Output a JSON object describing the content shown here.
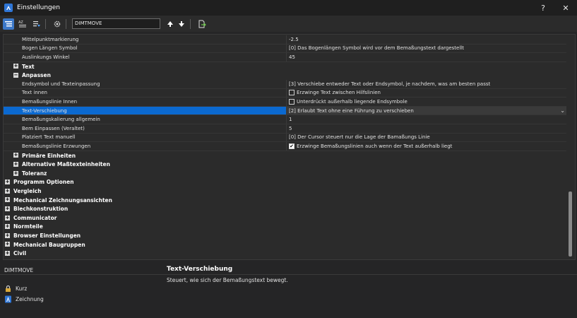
{
  "window": {
    "title": "Einstellungen",
    "help": "?",
    "close": "✕"
  },
  "toolbar": {
    "search_value": "DIMTMOVE"
  },
  "properties": [
    {
      "type": "prop",
      "name": "Mittelpunktmarkierung",
      "value": "-2.5"
    },
    {
      "type": "prop",
      "name": "Bogen Längen Symbol",
      "value": "[0] Das Bogenlängen Symbol wird vor dem Bemaßungstext dargestellt"
    },
    {
      "type": "prop",
      "name": "Auslinkungs Winkel",
      "value": "45"
    },
    {
      "type": "group",
      "level": 1,
      "expander": "+",
      "name": "Text"
    },
    {
      "type": "group",
      "level": 1,
      "expander": "−",
      "name": "Anpassen"
    },
    {
      "type": "prop",
      "name": "Endsymbol und Texteinpassung",
      "value": "[3] Verschiebe entweder Text oder Endsymbol, je nachdem, was am besten passt"
    },
    {
      "type": "prop",
      "name": "Text innen",
      "value": "Erzwinge Text zwischen Hilfslinien",
      "checkbox": "unchecked"
    },
    {
      "type": "prop",
      "name": "Bemaßungslinie Innen",
      "value": "Unterdrückt außerhalb liegende Endsymbole",
      "checkbox": "unchecked"
    },
    {
      "type": "prop",
      "name": "Text-Verschiebung",
      "value": "[2] Erlaubt Text ohne eine Führung zu verschieben",
      "selected": true
    },
    {
      "type": "prop",
      "name": "Bemaßungskalierung allgemein",
      "value": "1"
    },
    {
      "type": "prop",
      "name": "Bem Einpassen (Veraltet)",
      "value": "5"
    },
    {
      "type": "prop",
      "name": "Platziert Text manuell",
      "value": "[0] Der Cursor steuert nur die Lage der Bamaßungs Linie"
    },
    {
      "type": "prop",
      "name": "Bemaßungslinie Erzwungen",
      "value": "Erzwinge Bemaßungslinien auch wenn der Text außerhalb liegt",
      "checkbox": "checked"
    },
    {
      "type": "group",
      "level": 1,
      "expander": "+",
      "name": "Primäre Einheiten"
    },
    {
      "type": "group",
      "level": 1,
      "expander": "+",
      "name": "Alternative Maßtexteinheiten"
    },
    {
      "type": "group",
      "level": 1,
      "expander": "+",
      "name": "Toleranz"
    },
    {
      "type": "group",
      "level": 0,
      "expander": "+",
      "name": "Programm Optionen"
    },
    {
      "type": "group",
      "level": 0,
      "expander": "+",
      "name": "Vergleich"
    },
    {
      "type": "group",
      "level": 0,
      "expander": "+",
      "name": "Mechanical Zeichnungsansichten"
    },
    {
      "type": "group",
      "level": 0,
      "expander": "+",
      "name": "Blechkonstruktion"
    },
    {
      "type": "group",
      "level": 0,
      "expander": "+",
      "name": "Communicator"
    },
    {
      "type": "group",
      "level": 0,
      "expander": "+",
      "name": "Normteile"
    },
    {
      "type": "group",
      "level": 0,
      "expander": "+",
      "name": "Browser Einstellungen"
    },
    {
      "type": "group",
      "level": 0,
      "expander": "+",
      "name": "Mechanical Baugruppen"
    },
    {
      "type": "group",
      "level": 0,
      "expander": "+",
      "name": "Civil"
    }
  ],
  "bottom": {
    "variable": "DIMTMOVE",
    "desc_title": "Text-Verschiebung",
    "desc_text": "Steuert, wie sich der Bemaßungstext bewegt.",
    "nav": [
      {
        "label": "Kurz",
        "icon": "lock-icon"
      },
      {
        "label": "Zeichnung",
        "icon": "drawing-icon"
      }
    ]
  },
  "colors": {
    "selection": "#0b69d0",
    "accent": "#3c78c8"
  }
}
